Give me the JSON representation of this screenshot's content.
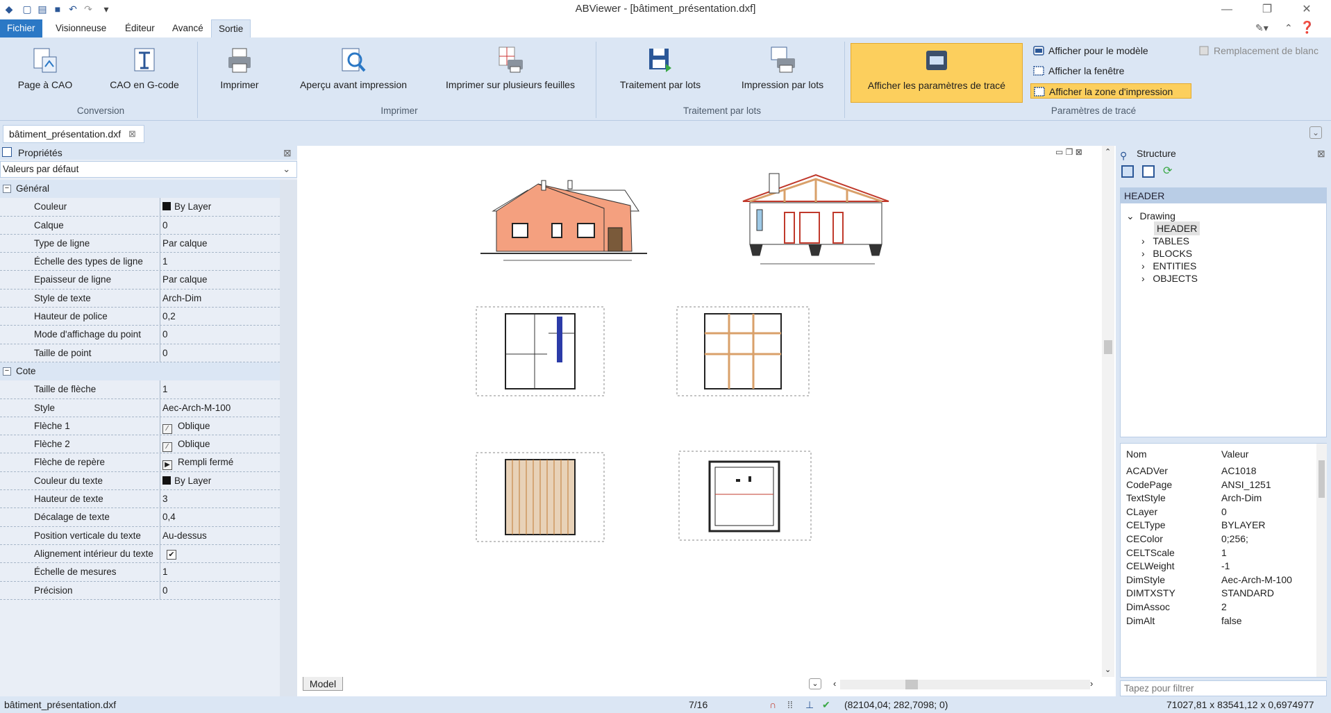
{
  "app": {
    "title": "ABViewer - [bâtiment_présentation.dxf]"
  },
  "tabs": [
    "Fichier",
    "Visionneuse",
    "Éditeur",
    "Avancé",
    "Sortie"
  ],
  "ribbon": {
    "conversion": {
      "label": "Conversion",
      "page_cao": "Page à CAO",
      "cao_gcode": "CAO en G-code"
    },
    "imprimer": {
      "label": "Imprimer",
      "imprimer": "Imprimer",
      "apercu": "Aperçu avant impression",
      "plusieurs": "Imprimer sur plusieurs feuilles"
    },
    "lots": {
      "label": "Traitement par lots",
      "traitement": "Traitement par lots",
      "impression": "Impression par lots"
    },
    "trace": {
      "label": "Paramètres de tracé",
      "afficher_params": "Afficher les paramètres de tracé",
      "pour_modele": "Afficher pour le modèle",
      "fenetre": "Afficher la fenêtre",
      "zone": "Afficher la zone d'impression",
      "remplacement": "Remplacement de blanc"
    }
  },
  "document_tab": "bâtiment_présentation.dxf",
  "properties": {
    "title": "Propriétés",
    "combo": "Valeurs par défaut",
    "cat_general": "Général",
    "cat_cote": "Cote",
    "general": [
      {
        "name": "Couleur",
        "value": "By Layer"
      },
      {
        "name": "Calque",
        "value": "0"
      },
      {
        "name": "Type de ligne",
        "value": "Par calque"
      },
      {
        "name": "Échelle des types de ligne",
        "value": "1"
      },
      {
        "name": "Epaisseur de ligne",
        "value": "Par calque"
      },
      {
        "name": "Style de texte",
        "value": "Arch-Dim"
      },
      {
        "name": "Hauteur de police",
        "value": "0,2"
      },
      {
        "name": "Mode d'affichage du point",
        "value": "0"
      },
      {
        "name": "Taille de point",
        "value": "0"
      }
    ],
    "cote": [
      {
        "name": "Taille de flèche",
        "value": "1"
      },
      {
        "name": "Style",
        "value": "Aec-Arch-M-100"
      },
      {
        "name": "Flèche 1",
        "value": "Oblique"
      },
      {
        "name": "Flèche 2",
        "value": "Oblique"
      },
      {
        "name": "Flèche de repère",
        "value": "Rempli fermé"
      },
      {
        "name": "Couleur du texte",
        "value": "By Layer"
      },
      {
        "name": "Hauteur de texte",
        "value": "3"
      },
      {
        "name": "Décalage de texte",
        "value": "0,4"
      },
      {
        "name": "Position verticale du texte",
        "value": "Au-dessus"
      },
      {
        "name": "Alignement intérieur du texte",
        "value": "✔"
      },
      {
        "name": "Échelle de mesures",
        "value": "1"
      },
      {
        "name": "Précision",
        "value": "0"
      }
    ]
  },
  "canvas": {
    "model_tab": "Model"
  },
  "structure": {
    "title": "Structure",
    "header_label": "HEADER",
    "tree": {
      "root": "Drawing",
      "children": [
        "HEADER",
        "TABLES",
        "BLOCKS",
        "ENTITIES",
        "OBJECTS"
      ]
    },
    "kv_headers": {
      "name": "Nom",
      "value": "Valeur"
    },
    "kv": [
      {
        "k": "ACADVer",
        "v": "AC1018"
      },
      {
        "k": "CodePage",
        "v": "ANSI_1251"
      },
      {
        "k": "TextStyle",
        "v": "Arch-Dim"
      },
      {
        "k": "CLayer",
        "v": "0"
      },
      {
        "k": "CELType",
        "v": "BYLAYER"
      },
      {
        "k": "CEColor",
        "v": "0;256;"
      },
      {
        "k": "CELTScale",
        "v": "1"
      },
      {
        "k": "CELWeight",
        "v": "-1"
      },
      {
        "k": "DimStyle",
        "v": "Aec-Arch-M-100"
      },
      {
        "k": "DIMTXSTY",
        "v": "STANDARD"
      },
      {
        "k": "DimAssoc",
        "v": "2"
      },
      {
        "k": "DimAlt",
        "v": "false"
      }
    ],
    "filter_placeholder": "Tapez pour filtrer"
  },
  "status": {
    "file": "bâtiment_présentation.dxf",
    "page": "7/16",
    "coords": "(82104,04; 282,7098; 0)",
    "size": "71027,81 x 83541,12 x 0,6974977"
  },
  "colors": {
    "accent": "#2b78c5",
    "ribbon": "#dbe6f4",
    "highlight": "#fccf5d",
    "wall": "#f4a07f",
    "wood": "#d9a06a"
  }
}
